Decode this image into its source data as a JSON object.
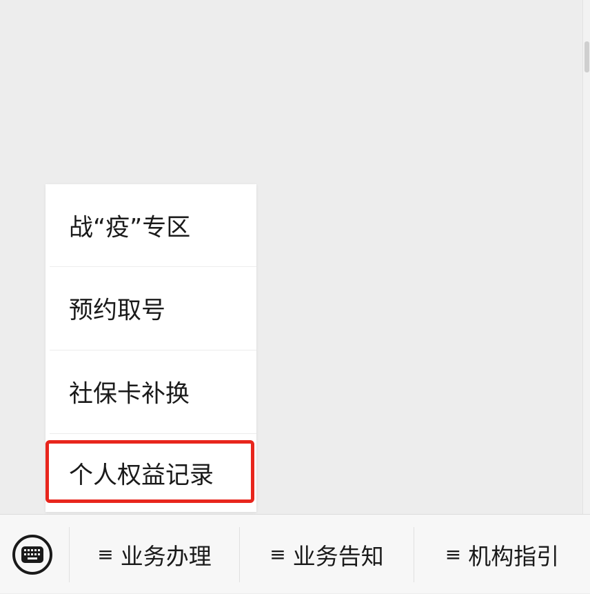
{
  "popup_menu": {
    "items": [
      {
        "label": "战“疫”专区"
      },
      {
        "label": "预约取号"
      },
      {
        "label": "社保卡补换"
      },
      {
        "label": "个人权益记录"
      }
    ],
    "highlighted_index": 3,
    "highlight_color": "#e8261d"
  },
  "bottom_bar": {
    "keyboard_icon": "keyboard-icon",
    "menus": [
      {
        "icon": "hamburger-icon",
        "label": "业务办理"
      },
      {
        "icon": "hamburger-icon",
        "label": "业务告知"
      },
      {
        "icon": "hamburger-icon",
        "label": "机构指引"
      }
    ]
  },
  "colors": {
    "background": "#ededed",
    "menu_background": "#ffffff",
    "bar_background": "#f7f7f7",
    "text": "#1a1a1a"
  }
}
